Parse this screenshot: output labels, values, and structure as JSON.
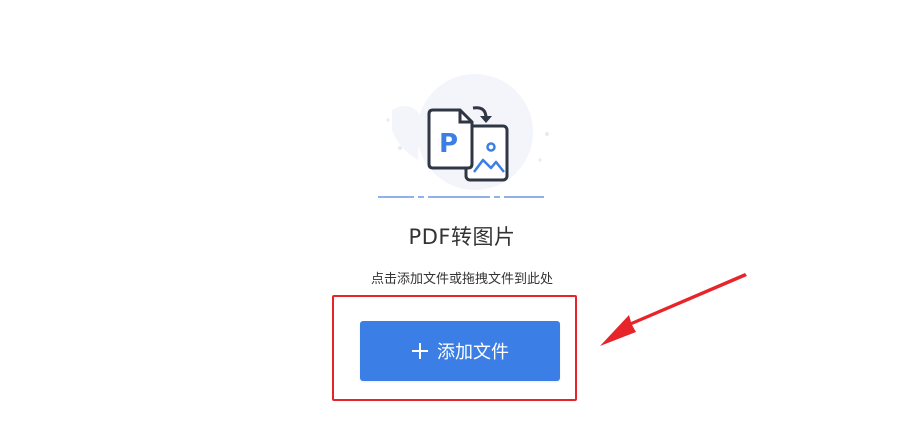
{
  "main": {
    "title": "PDF转图片",
    "hint": "点击添加文件或拖拽文件到此处",
    "add_button_label": "添加文件"
  },
  "icons": {
    "illustration": "pdf-to-image-icon",
    "add": "plus-icon",
    "annotation": "red-arrow-icon"
  },
  "colors": {
    "accent": "#3a7ee6",
    "annotation_red": "#e8242b",
    "text": "#333333"
  }
}
